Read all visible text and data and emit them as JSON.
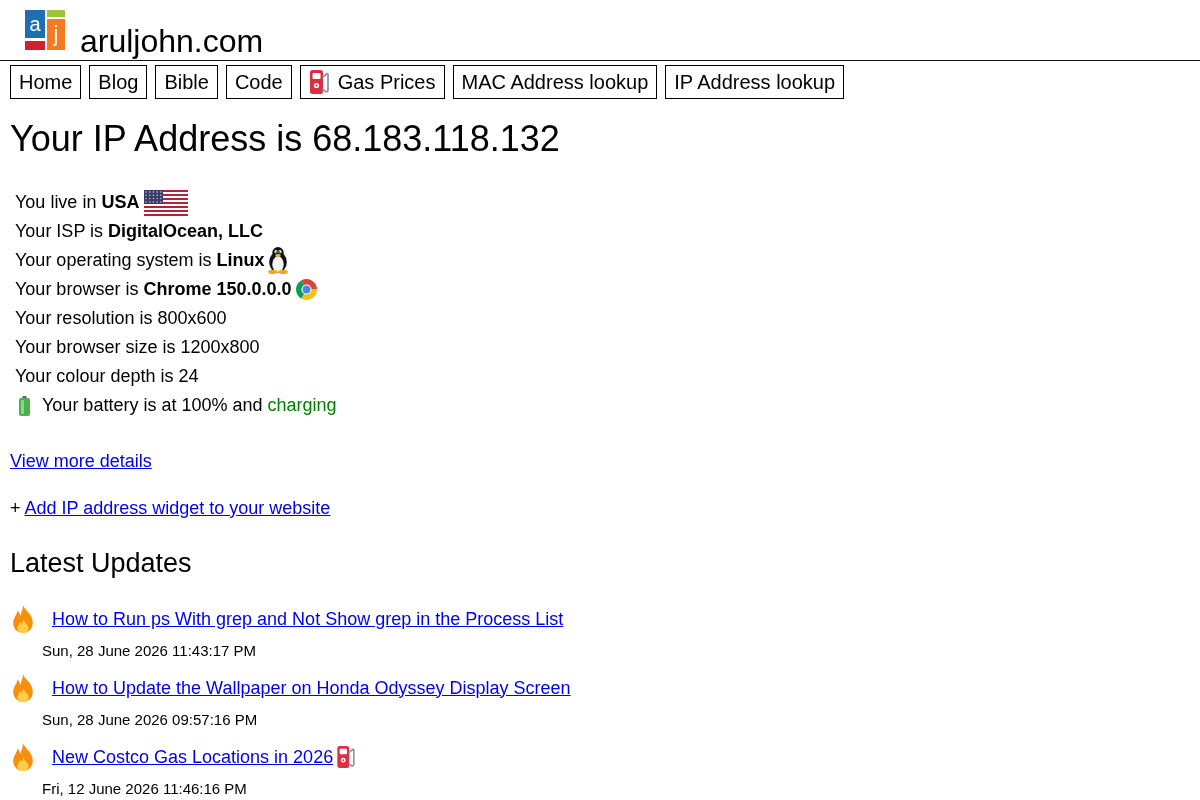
{
  "site": {
    "logo": [
      "a",
      "j"
    ],
    "name": "aruljohn.com"
  },
  "nav": [
    {
      "label": "Home",
      "kind": "plain"
    },
    {
      "label": "Blog",
      "kind": "plain"
    },
    {
      "label": "Bible",
      "kind": "plain"
    },
    {
      "label": "Code",
      "kind": "plain"
    },
    {
      "label": "Gas Prices",
      "kind": "fuel"
    },
    {
      "label": "MAC Address lookup",
      "kind": "plain"
    },
    {
      "label": "IP Address lookup",
      "kind": "plain"
    }
  ],
  "heading": "Your IP Address is 68.183.118.132",
  "details": [
    {
      "text": "You live in **USA**",
      "kind": "flag"
    },
    {
      "text": "Your ISP is **DigitalOcean, LLC**",
      "kind": "plain"
    },
    {
      "text": "Your operating system is **Linux**",
      "kind": "penguin"
    },
    {
      "text": "Your browser is **Chrome 150.0.0.0**",
      "kind": "browser"
    },
    {
      "text": "Your resolution is 800x600",
      "kind": "plain"
    },
    {
      "text": "Your browser size is 1200x800",
      "kind": "plain"
    },
    {
      "text": "Your colour depth is 24",
      "kind": "plain"
    },
    {
      "text": "Your battery is at 100% and",
      "status": "charging",
      "kind": "battery"
    }
  ],
  "more_link": "View more details",
  "widget": {
    "prefix": "+",
    "link": "Add IP address widget to your website"
  },
  "updates": {
    "title": "Latest Updates",
    "items": [
      {
        "title": "How to Run ps With grep and Not Show grep in the Process List",
        "date": "Sun, 28 June 2026 11:43:17 PM",
        "kind": "plain"
      },
      {
        "title": "How to Update the Wallpaper on Honda Odyssey Display Screen",
        "date": "Sun, 28 June 2026 09:57:16 PM",
        "kind": "plain"
      },
      {
        "title": "New Costco Gas Locations in 2026",
        "date": "Fri, 12 June 2026 11:46:16 PM",
        "kind": "fuel"
      }
    ]
  }
}
